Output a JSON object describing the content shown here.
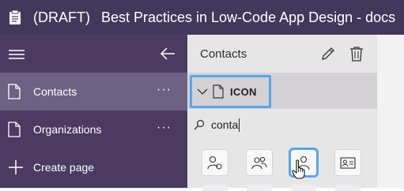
{
  "titlebar": {
    "draft": "(DRAFT)",
    "title": "Best Practices in Low-Code App Design - docs"
  },
  "sidebar": {
    "items": [
      {
        "label": "Contacts",
        "more": "···",
        "selected": true
      },
      {
        "label": "Organizations",
        "more": "···",
        "selected": false
      }
    ],
    "create_label": "Create page"
  },
  "panel": {
    "title": "Contacts",
    "icon_group": {
      "label": "ICON"
    },
    "search": {
      "value": "conta"
    },
    "tiles": [
      "person-link-icon",
      "people-icon",
      "person-icon",
      "contact-card-icon"
    ]
  },
  "colors": {
    "titlebar_bg": "#42385c",
    "sidebar_bg": "#4b3a62",
    "sidebar_selected": "#6d6283",
    "highlight": "#55a7f0",
    "panel_bg": "#e7e6e7"
  }
}
